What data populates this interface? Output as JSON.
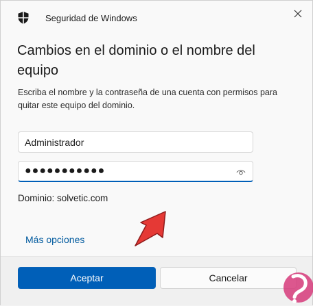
{
  "window": {
    "app_title": "Seguridad de Windows",
    "app_icon": "shield-icon",
    "close_icon": "close-icon"
  },
  "dialog": {
    "heading": "Cambios en el dominio o el nombre del equipo",
    "description": "Escriba el nombre y la contraseña de una cuenta con permisos para quitar este equipo del dominio.",
    "username_value": "Administrador",
    "password_value": "●●●●●●●●●●●",
    "reveal_password_icon": "eye-icon",
    "domain_text": "Dominio: solvetic.com",
    "more_options": "Más opciones"
  },
  "buttons": {
    "ok": "Aceptar",
    "cancel": "Cancelar"
  },
  "colors": {
    "accent": "#005fb8",
    "link": "#005a9e",
    "annotation_arrow": "#e53935"
  }
}
